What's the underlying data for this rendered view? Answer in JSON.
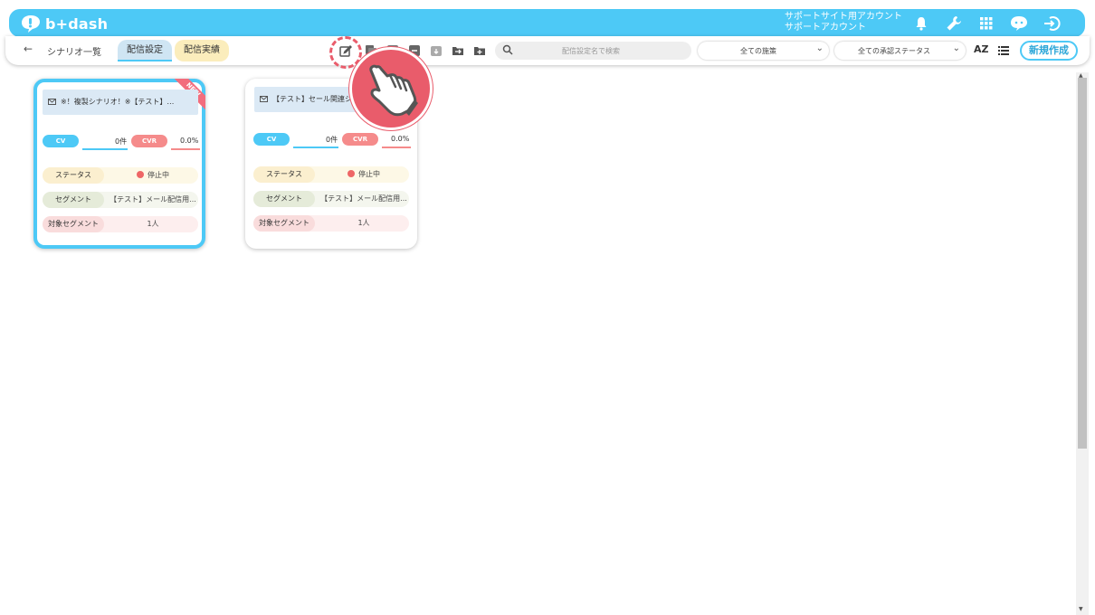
{
  "header": {
    "logo_text": "b+dash",
    "account_line1": "サポートサイト用アカウント",
    "account_line2": "サポートアカウント",
    "icons": [
      "bell-icon",
      "wrench-icon",
      "grid-icon",
      "chat-bot-icon",
      "logout-icon"
    ]
  },
  "toolbar": {
    "back_icon": "←",
    "breadcrumb": "シナリオ一覧",
    "tabs": [
      {
        "label": "配信設定",
        "active": true
      },
      {
        "label": "配信実績",
        "active": false
      }
    ],
    "tools": [
      "edit-icon",
      "copy-icon",
      "move-icon",
      "export-icon",
      "archive-icon",
      "folder-move-icon",
      "folder-add-icon"
    ],
    "search_placeholder": "配信設定名で検索",
    "filter_measure": "全ての施策",
    "filter_approval": "全ての承認ステータス",
    "sort_label": "AZ",
    "new_button": "新規作成"
  },
  "cards": [
    {
      "title": "※！複製シナリオ！※【テスト】…",
      "is_new": true,
      "new_label": "NEW",
      "cv_label": "CV",
      "cv_value": "0件",
      "cvr_label": "CVR",
      "cvr_value": "0.0%",
      "status_label": "ステータス",
      "status_value": "停止中",
      "segment_label": "セグメント",
      "segment_value": "【テスト】メール配信用...",
      "target_label": "対象セグメント",
      "target_value": "1人"
    },
    {
      "title": "【テスト】セール関連シ",
      "is_new": false,
      "cv_label": "CV",
      "cv_value": "0件",
      "cvr_label": "CVR",
      "cvr_value": "0.0%",
      "status_label": "ステータス",
      "status_value": "停止中",
      "segment_label": "セグメント",
      "segment_value": "【テスト】メール配信用...",
      "target_label": "対象セグメント",
      "target_value": "1人"
    }
  ],
  "colors": {
    "accent": "#4dc9f6",
    "cvr": "#f58b8b",
    "highlight": "#e95c6b"
  }
}
